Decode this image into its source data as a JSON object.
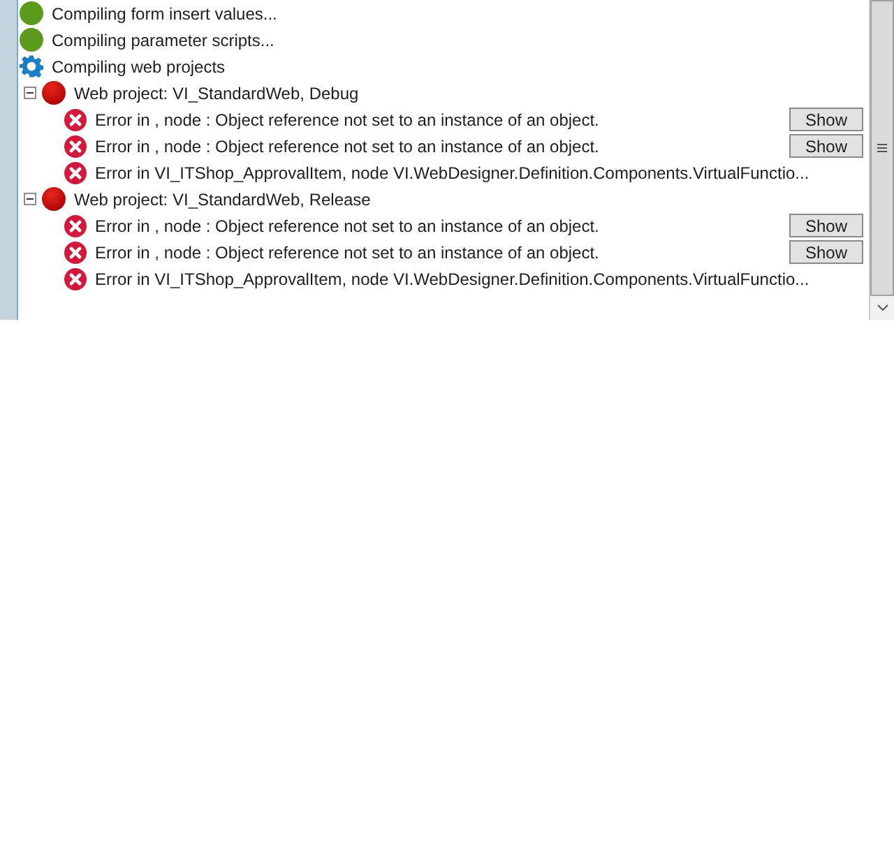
{
  "steps": [
    {
      "kind": "done",
      "label": "Compiling form insert values..."
    },
    {
      "kind": "done",
      "label": "Compiling parameter scripts..."
    },
    {
      "kind": "running",
      "label": "Compiling web projects",
      "children": [
        {
          "kind": "failed",
          "label": "Web project: VI_StandardWeb, Debug",
          "expanded": true,
          "children": [
            {
              "kind": "error",
              "label": "Error in , node : Object reference not set to an instance of an object.",
              "button": "Show"
            },
            {
              "kind": "error",
              "label": "Error in , node : Object reference not set to an instance of an object.",
              "button": "Show"
            },
            {
              "kind": "error",
              "label": "Error in VI_ITShop_ApprovalItem, node VI.WebDesigner.Definition.Components.VirtualFunctio..."
            }
          ]
        },
        {
          "kind": "failed",
          "label": "Web project: VI_StandardWeb, Release",
          "expanded": true,
          "children": [
            {
              "kind": "error",
              "label": "Error in , node : Object reference not set to an instance of an object.",
              "button": "Show"
            },
            {
              "kind": "error",
              "label": "Error in , node : Object reference not set to an instance of an object.",
              "button": "Show"
            },
            {
              "kind": "error",
              "label": "Error in VI_ITShop_ApprovalItem, node VI.WebDesigner.Definition.Components.VirtualFunctio..."
            }
          ]
        }
      ]
    }
  ]
}
